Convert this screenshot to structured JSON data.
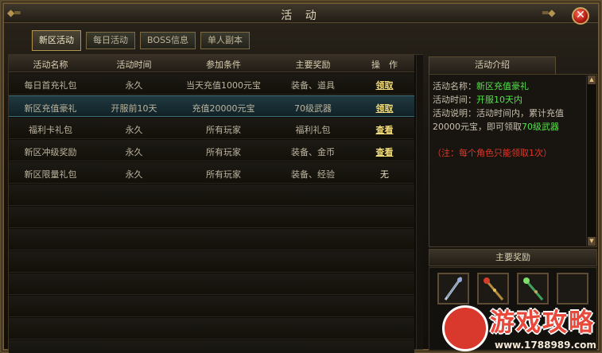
{
  "window": {
    "title": "活 动",
    "close_icon": "close-icon"
  },
  "tabs": [
    {
      "label": "新区活动",
      "active": true
    },
    {
      "label": "每日活动",
      "active": false
    },
    {
      "label": "BOSS信息",
      "active": false
    },
    {
      "label": "单人副本",
      "active": false
    }
  ],
  "table": {
    "headers": [
      "活动名称",
      "活动时间",
      "参加条件",
      "主要奖励",
      "操　作"
    ],
    "rows": [
      {
        "name": "每日首充礼包",
        "time": "永久",
        "condition": "当天充值1000元宝",
        "reward": "装备、道具",
        "action": "领取",
        "action_type": "link",
        "selected": false
      },
      {
        "name": "新区充值豪礼",
        "time": "开服前10天",
        "condition": "充值20000元宝",
        "reward": "70级武器",
        "action": "领取",
        "action_type": "link",
        "selected": true
      },
      {
        "name": "福利卡礼包",
        "time": "永久",
        "condition": "所有玩家",
        "reward": "福利礼包",
        "action": "查看",
        "action_type": "link",
        "selected": false
      },
      {
        "name": "新区冲级奖励",
        "time": "永久",
        "condition": "所有玩家",
        "reward": "装备、金币",
        "action": "查看",
        "action_type": "link",
        "selected": false
      },
      {
        "name": "新区限量礼包",
        "time": "永久",
        "condition": "所有玩家",
        "reward": "装备、经验",
        "action": "无",
        "action_type": "plain",
        "selected": false
      }
    ]
  },
  "intro": {
    "tab_label": "活动介绍",
    "name_label": "活动名称：",
    "name_value": "新区充值豪礼",
    "time_label": "活动时间：",
    "time_value": "开服10天内",
    "desc_label": "活动说明：",
    "desc_text": "活动时间内，累计充值20000元宝，即可领取",
    "desc_highlight": "70级武器",
    "note": "（注：每个角色只能领取1次）"
  },
  "rewards": {
    "header": "主要奖励",
    "items": [
      "sword-icon",
      "staff-icon",
      "green-staff-icon",
      "empty-slot"
    ]
  },
  "watermark": {
    "title": "游戏攻略",
    "url": "www.1788989.com"
  },
  "colors": {
    "highlight_green": "#54e34a",
    "note_red": "#e0362a",
    "link_yellow": "#f3dc7a"
  }
}
